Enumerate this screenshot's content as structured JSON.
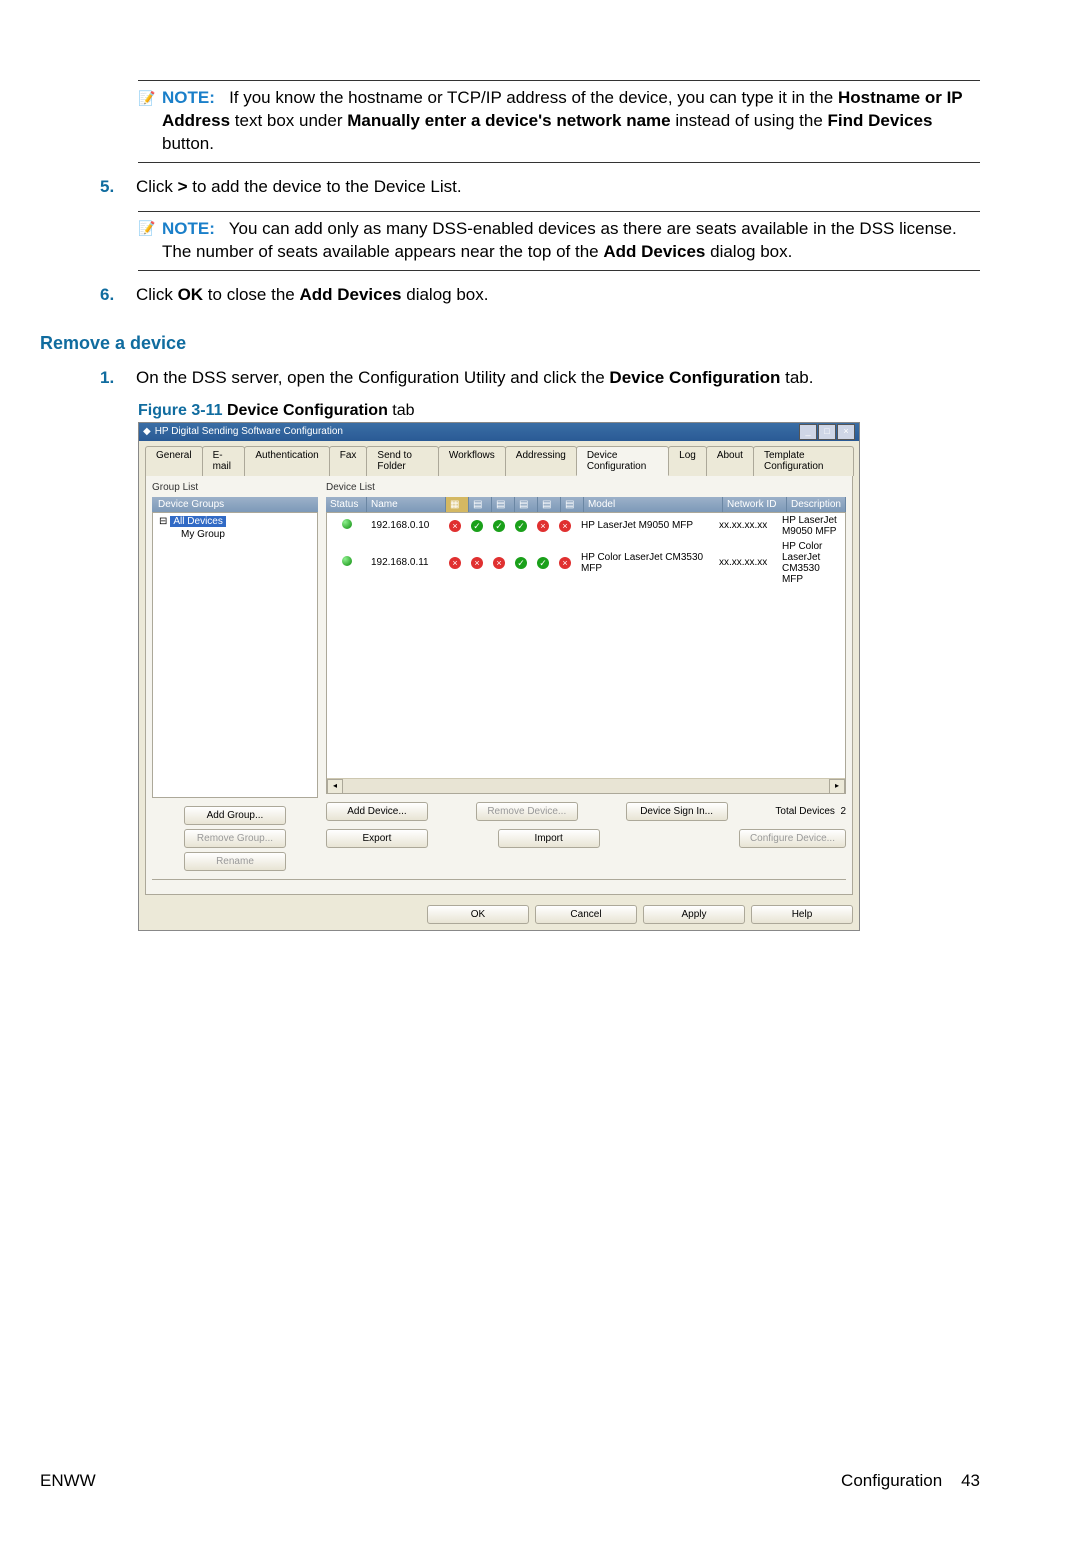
{
  "note1": {
    "label": "NOTE:",
    "text_a": "If you know the hostname or TCP/IP address of the device, you can type it in the ",
    "bold_a": "Hostname or IP Address",
    "text_b": " text box under ",
    "bold_b": "Manually enter a device's network name",
    "text_c": " instead of using the ",
    "bold_c": "Find Devices",
    "text_d": " button."
  },
  "step5": {
    "num": "5.",
    "text_a": "Click ",
    "bold_a": ">",
    "text_b": " to add the device to the Device List."
  },
  "note2": {
    "label": "NOTE:",
    "text_a": "You can add only as many DSS-enabled devices as there are seats available in the DSS license. The number of seats available appears near the top of the ",
    "bold_a": "Add Devices",
    "text_b": " dialog box."
  },
  "step6": {
    "num": "6.",
    "text_a": "Click ",
    "bold_a": "OK",
    "text_b": " to close the ",
    "bold_b": "Add Devices",
    "text_c": " dialog box."
  },
  "h3": "Remove a device",
  "r_step1": {
    "num": "1.",
    "text_a": "On the DSS server, open the Configuration Utility and click the ",
    "bold_a": "Device Configuration",
    "text_b": " tab."
  },
  "fig": {
    "num": "Figure 3-11",
    "caption": " Device Configuration",
    "suffix": " tab"
  },
  "app": {
    "title": "HP Digital Sending Software Configuration",
    "tabs": [
      "General",
      "E-mail",
      "Authentication",
      "Fax",
      "Send to Folder",
      "Workflows",
      "Addressing",
      "Device Configuration",
      "Log",
      "About",
      "Template Configuration"
    ],
    "active_tab_index": 7,
    "group_list_label": "Group List",
    "device_list_label": "Device List",
    "groups_header": "Device Groups",
    "tree": {
      "root": "All Devices",
      "child": "My Group"
    },
    "columns": {
      "status": "Status",
      "name": "Name",
      "model": "Model",
      "network": "Network ID",
      "desc": "Description"
    },
    "rows": [
      {
        "name": "192.168.0.10",
        "icons": [
          "x",
          "v",
          "v",
          "v",
          "x",
          "x"
        ],
        "model": "HP LaserJet M9050 MFP",
        "network": "xx.xx.xx.xx",
        "desc": "HP LaserJet M9050 MFP"
      },
      {
        "name": "192.168.0.11",
        "icons": [
          "x",
          "x",
          "x",
          "v",
          "v",
          "x"
        ],
        "model": "HP Color LaserJet CM3530 MFP",
        "network": "xx.xx.xx.xx",
        "desc": "HP Color LaserJet CM3530 MFP"
      }
    ],
    "buttons": {
      "add_group": "Add Group...",
      "remove_group": "Remove Group...",
      "rename": "Rename",
      "add_device": "Add Device...",
      "export": "Export",
      "remove_device": "Remove Device...",
      "import": "Import",
      "sign_in": "Device Sign In...",
      "configure": "Configure Device...",
      "total_label": "Total Devices",
      "total_value": "2",
      "ok": "OK",
      "cancel": "Cancel",
      "apply": "Apply",
      "help": "Help"
    }
  },
  "footer": {
    "left": "ENWW",
    "right_label": "Configuration",
    "right_page": "43"
  }
}
